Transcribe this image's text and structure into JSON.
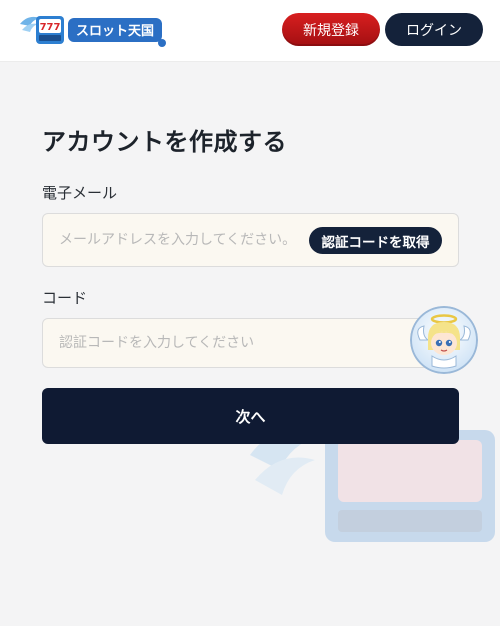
{
  "header": {
    "logo_icon": "slot-tengoku-logo",
    "logo_text": "スロット天国",
    "logo_badge": "777",
    "register_label": "新規登録",
    "login_label": "ログイン"
  },
  "form": {
    "title": "アカウントを作成する",
    "email_label": "電子メール",
    "email_placeholder": "メールアドレスを入力してください。",
    "get_code_label": "認証コードを取得",
    "code_label": "コード",
    "code_placeholder": "認証コードを入力してください",
    "next_label": "次へ"
  },
  "support": {
    "icon": "angel-mascot-icon"
  },
  "colors": {
    "register_red": "#c0181a",
    "navy": "#14223a",
    "next_navy": "#0f1a33",
    "background": "#f4f4f5",
    "input_bg": "#fbf8f1"
  }
}
